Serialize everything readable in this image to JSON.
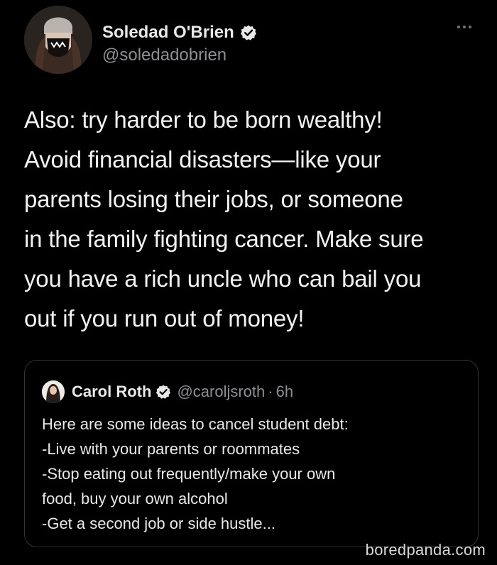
{
  "tweet": {
    "author": {
      "display_name": "Soledad O'Brien",
      "handle": "@soledadobrien",
      "verified": true
    },
    "more_icon": "more-horizontal-icon",
    "text": "Also: try harder to be born wealthy!\nAvoid financial disasters—like your\nparents losing their jobs, or someone\nin the family fighting cancer. Make sure\nyou have a rich uncle who can bail you\nout if you run out of money!"
  },
  "quoted_tweet": {
    "author": {
      "display_name": "Carol Roth",
      "handle": "@caroljsroth",
      "verified": true
    },
    "separator": "·",
    "time": "6h",
    "text": "Here are some ideas to cancel student debt:\n-Live with your parents or roommates\n-Stop eating out frequently/make your own\nfood, buy your own alcohol\n-Get a second job or side hustle..."
  },
  "watermark": "boredpanda.com",
  "colors": {
    "background": "#000000",
    "text": "#f2f2f2",
    "secondary": "#8e8e93",
    "verified_badge": "#e8e8e8",
    "border": "#2f3336"
  }
}
